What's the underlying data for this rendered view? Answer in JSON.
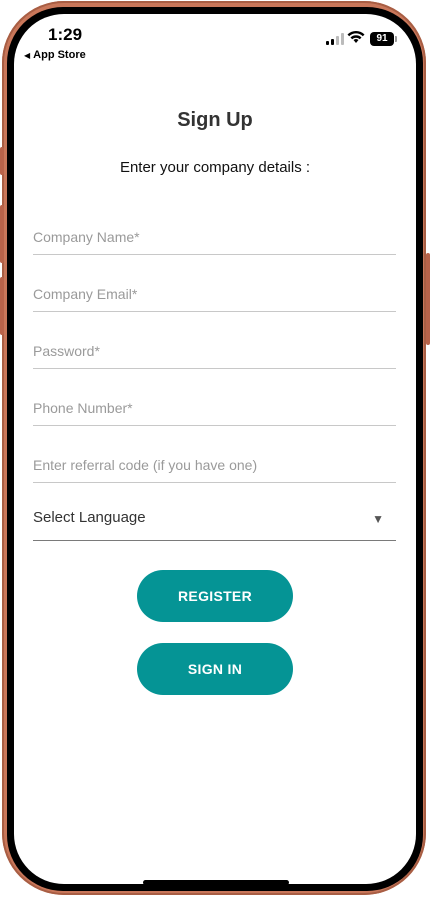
{
  "status": {
    "time": "1:29",
    "back_label": "App Store",
    "battery": "91"
  },
  "page": {
    "title": "Sign Up",
    "subtitle": "Enter your company details :"
  },
  "form": {
    "company_name_placeholder": "Company Name*",
    "company_email_placeholder": "Company Email*",
    "password_placeholder": "Password*",
    "phone_placeholder": "Phone Number*",
    "referral_placeholder": "Enter referral code (if you have one)",
    "language_label": "Select Language"
  },
  "buttons": {
    "register": "REGISTER",
    "signin": "SIGN IN"
  },
  "colors": {
    "accent": "#059495",
    "frame": "#c9775a"
  }
}
